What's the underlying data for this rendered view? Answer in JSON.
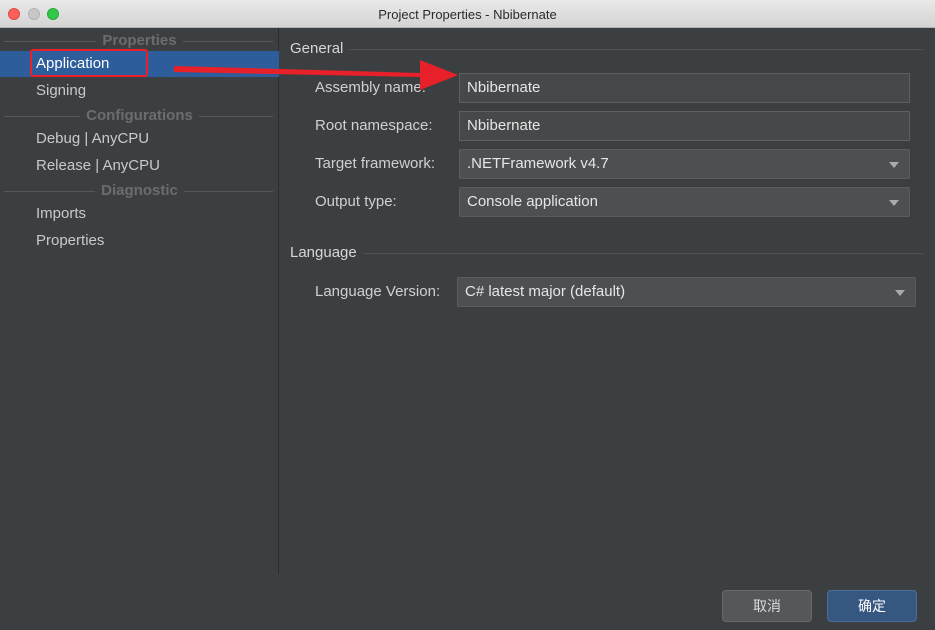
{
  "window": {
    "title": "Project Properties - Nbibernate"
  },
  "sidebar": {
    "groups": [
      {
        "header": "Properties",
        "items": [
          "Application",
          "Signing"
        ]
      },
      {
        "header": "Configurations",
        "items": [
          "Debug | AnyCPU",
          "Release | AnyCPU"
        ]
      },
      {
        "header": "Diagnostic",
        "items": [
          "Imports",
          "Properties"
        ]
      }
    ],
    "selected": "Application"
  },
  "general": {
    "section_label": "General",
    "assembly_name_label": "Assembly name:",
    "assembly_name_value": "Nbibernate",
    "root_namespace_label": "Root namespace:",
    "root_namespace_value": "Nbibernate",
    "target_framework_label": "Target framework:",
    "target_framework_value": ".NETFramework v4.7",
    "output_type_label": "Output type:",
    "output_type_value": "Console application"
  },
  "language": {
    "section_label": "Language",
    "language_version_label": "Language Version:",
    "language_version_value": "C# latest major (default)"
  },
  "buttons": {
    "cancel": "取消",
    "ok": "确定"
  },
  "colors": {
    "selection": "#2d5d9a",
    "annotation": "#e8202a",
    "ok_button": "#365880"
  }
}
